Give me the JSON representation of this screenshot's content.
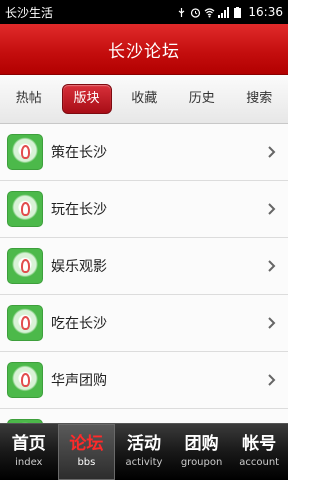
{
  "status_bar": {
    "app_name": "长沙生活",
    "time": "16:36",
    "icons": [
      "usb-icon",
      "alarm-icon",
      "wifi-icon",
      "signal-icon",
      "battery-icon"
    ]
  },
  "title_bar": {
    "title": "长沙论坛"
  },
  "tabs": [
    {
      "label": "热帖",
      "active": false
    },
    {
      "label": "版块",
      "active": true
    },
    {
      "label": "收藏",
      "active": false
    },
    {
      "label": "历史",
      "active": false
    },
    {
      "label": "搜索",
      "active": false
    }
  ],
  "list": {
    "items": [
      {
        "label": "策在长沙"
      },
      {
        "label": "玩在长沙"
      },
      {
        "label": "娱乐观影"
      },
      {
        "label": "吃在长沙"
      },
      {
        "label": "华声团购"
      },
      {
        "label": ""
      }
    ]
  },
  "bottom_nav": [
    {
      "label": "首页",
      "sub": "index",
      "active": false
    },
    {
      "label": "论坛",
      "sub": "bbs",
      "active": true
    },
    {
      "label": "活动",
      "sub": "activity",
      "active": false
    },
    {
      "label": "团购",
      "sub": "groupon",
      "active": false
    },
    {
      "label": "帐号",
      "sub": "account",
      "active": false
    }
  ],
  "colors": {
    "brand_red": "#c30d0d",
    "active_tab": "#b8141d",
    "nav_active_text": "#ff2a2a"
  }
}
